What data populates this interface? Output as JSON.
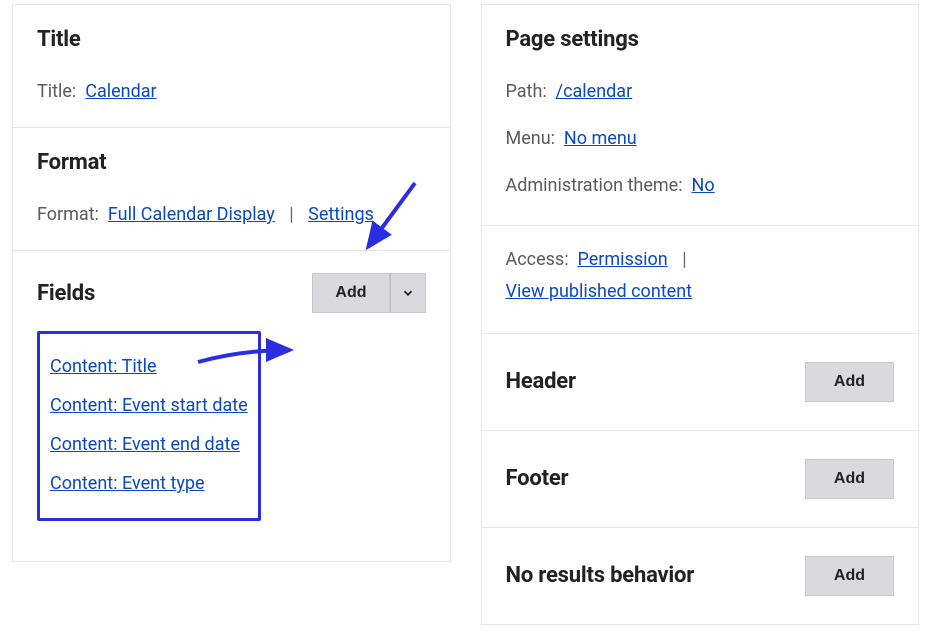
{
  "left": {
    "title_panel": {
      "heading": "Title",
      "label": "Title:",
      "value": "Calendar"
    },
    "format_panel": {
      "heading": "Format",
      "label": "Format:",
      "format_value": "Full Calendar Display",
      "settings_label": "Settings"
    },
    "fields_panel": {
      "heading": "Fields",
      "add_label": "Add",
      "items": [
        "Content: Title",
        "Content: Event start date",
        "Content: Event end date",
        "Content: Event type"
      ]
    }
  },
  "right": {
    "page_settings": {
      "heading": "Page settings",
      "path_label": "Path:",
      "path_value": "/calendar",
      "menu_label": "Menu:",
      "menu_value": "No menu",
      "admin_theme_label": "Administration theme:",
      "admin_theme_value": "No"
    },
    "access": {
      "label": "Access:",
      "permission": "Permission",
      "view_published": "View published content"
    },
    "header": {
      "heading": "Header",
      "add_label": "Add"
    },
    "footer": {
      "heading": "Footer",
      "add_label": "Add"
    },
    "no_results": {
      "heading": "No results behavior",
      "add_label": "Add"
    }
  }
}
